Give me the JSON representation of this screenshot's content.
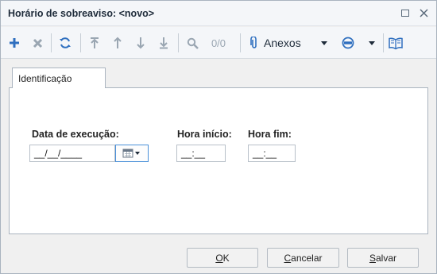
{
  "window": {
    "title": "Horário de sobreaviso: <novo>"
  },
  "toolbar": {
    "counter": "0/0",
    "attachments_label": "Anexos"
  },
  "tabs": [
    {
      "label": "Identificação",
      "active": true
    }
  ],
  "form": {
    "execution_date": {
      "label": "Data de execução:",
      "value": "__/__/____"
    },
    "start_time": {
      "label": "Hora início:",
      "value": "__:__"
    },
    "end_time": {
      "label": "Hora fim:",
      "value": "__:__"
    }
  },
  "footer": {
    "ok": {
      "accel": "O",
      "rest": "K"
    },
    "cancel": {
      "accel": "C",
      "rest": "ancelar"
    },
    "save": {
      "accel": "S",
      "rest": "alvar"
    }
  },
  "colors": {
    "accent_blue": "#2f6fbf",
    "disabled_gray": "#9aa6b2"
  },
  "icons": [
    "add-icon",
    "delete-icon",
    "refresh-icon",
    "first-record-icon",
    "previous-record-icon",
    "next-record-icon",
    "last-record-icon",
    "search-icon",
    "paperclip-icon",
    "dropdown-arrow-icon",
    "workflow-icon",
    "help-book-icon",
    "calendar-icon",
    "maximize-icon",
    "close-icon"
  ]
}
